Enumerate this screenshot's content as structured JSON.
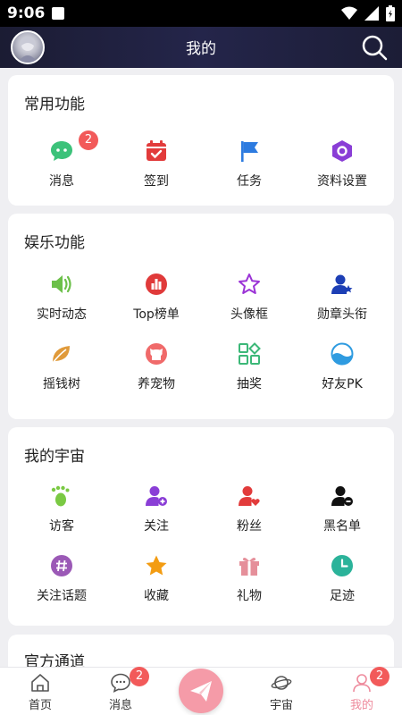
{
  "status_bar": {
    "time": "9:06"
  },
  "header": {
    "title": "我的"
  },
  "sections": {
    "common": {
      "title": "常用功能",
      "items": [
        {
          "label": "消息",
          "icon": "chat-bubble-icon",
          "color": "#3cc27a",
          "badge": "2"
        },
        {
          "label": "签到",
          "icon": "calendar-check-icon",
          "color": "#e23b3b"
        },
        {
          "label": "任务",
          "icon": "flag-icon",
          "color": "#2d7be0"
        },
        {
          "label": "资料设置",
          "icon": "hexagon-settings-icon",
          "color": "#8a3ed6"
        }
      ]
    },
    "entertainment": {
      "title": "娱乐功能",
      "items": [
        {
          "label": "实时动态",
          "icon": "speaker-icon",
          "color": "#6cc04a"
        },
        {
          "label": "Top榜单",
          "icon": "bar-chart-icon",
          "color": "#e03a3a"
        },
        {
          "label": "头像框",
          "icon": "star-outline-icon",
          "color": "#9b33d6"
        },
        {
          "label": "勋章头衔",
          "icon": "user-medal-icon",
          "color": "#1d3fb5"
        },
        {
          "label": "摇钱树",
          "icon": "leaf-icon",
          "color": "#e09a3a"
        },
        {
          "label": "养宠物",
          "icon": "github-cat-icon",
          "color": "#f06a6a"
        },
        {
          "label": "抽奖",
          "icon": "grid-apps-icon",
          "color": "#3cb878"
        },
        {
          "label": "好友PK",
          "icon": "wave-circle-icon",
          "color": "#2f9be0"
        }
      ]
    },
    "universe": {
      "title": "我的宇宙",
      "items": [
        {
          "label": "访客",
          "icon": "footprint-icon",
          "color": "#7ac943"
        },
        {
          "label": "关注",
          "icon": "user-add-icon",
          "color": "#8a3ed6"
        },
        {
          "label": "粉丝",
          "icon": "user-heart-icon",
          "color": "#e23b3b"
        },
        {
          "label": "黑名单",
          "icon": "user-block-icon",
          "color": "#111111"
        },
        {
          "label": "关注话题",
          "icon": "hashtag-icon",
          "color": "#9b59b6"
        },
        {
          "label": "收藏",
          "icon": "star-filled-icon",
          "color": "#f39c12"
        },
        {
          "label": "礼物",
          "icon": "gift-icon",
          "color": "#e58f9a"
        },
        {
          "label": "足迹",
          "icon": "clock-icon",
          "color": "#2bb39a"
        }
      ]
    },
    "official": {
      "title": "官方通道"
    }
  },
  "tabs": [
    {
      "label": "首页",
      "icon": "home-icon"
    },
    {
      "label": "消息",
      "icon": "message-icon",
      "badge": "2"
    },
    {
      "label": "宇宙",
      "icon": "planet-icon"
    },
    {
      "label": "我的",
      "icon": "user-icon",
      "badge": "2",
      "active": true
    }
  ],
  "colors": {
    "accent": "#f59ba8",
    "badge": "#f25a5a",
    "header": "#1f2040"
  }
}
